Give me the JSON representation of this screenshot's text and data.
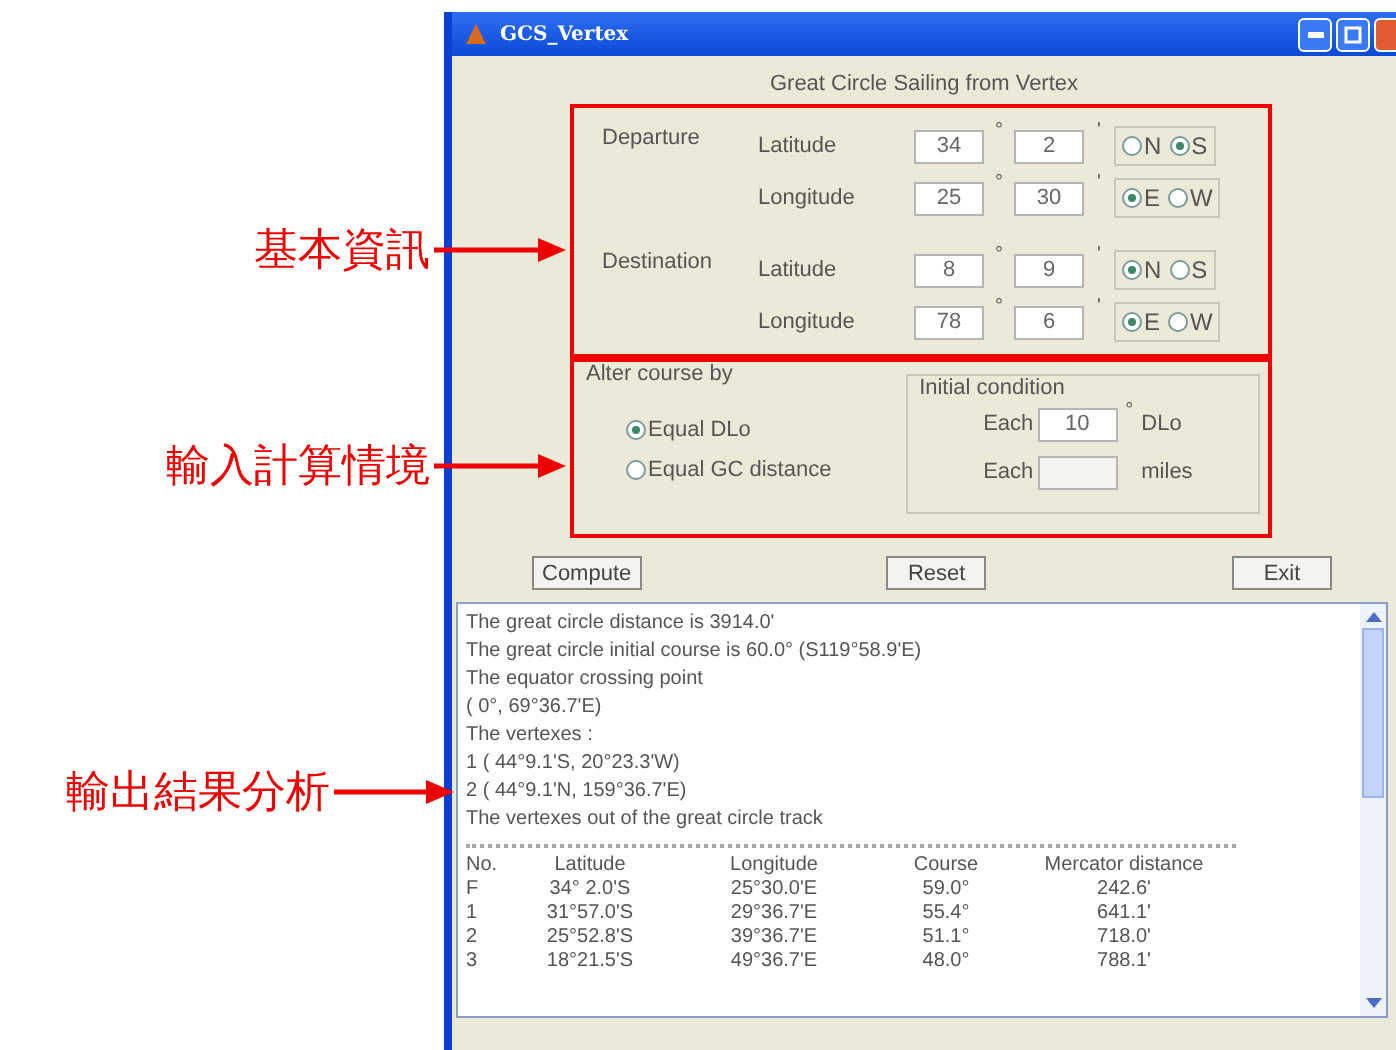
{
  "window": {
    "title": "GCS_Vertex"
  },
  "heading": "Great Circle Sailing from Vertex",
  "positions": [
    {
      "label": "Departure",
      "rows": [
        {
          "label": "Latitude",
          "degrees": "34",
          "degree_mark": "°",
          "minutes": "2",
          "minute_mark": "'",
          "options": [
            {
              "label": "N",
              "selected": false
            },
            {
              "label": "S",
              "selected": true
            }
          ]
        },
        {
          "label": "Longitude",
          "degrees": "25",
          "degree_mark": "°",
          "minutes": "30",
          "minute_mark": "'",
          "options": [
            {
              "label": "E",
              "selected": true
            },
            {
              "label": "W",
              "selected": false
            }
          ]
        }
      ]
    },
    {
      "label": "Destination",
      "rows": [
        {
          "label": "Latitude",
          "degrees": "8",
          "degree_mark": "°",
          "minutes": "9",
          "minute_mark": "'",
          "options": [
            {
              "label": "N",
              "selected": true
            },
            {
              "label": "S",
              "selected": false
            }
          ]
        },
        {
          "label": "Longitude",
          "degrees": "78",
          "degree_mark": "°",
          "minutes": "6",
          "minute_mark": "'",
          "options": [
            {
              "label": "E",
              "selected": true
            },
            {
              "label": "W",
              "selected": false
            }
          ]
        }
      ]
    }
  ],
  "alter_course": {
    "title": "Alter course by",
    "options": [
      {
        "label": "Equal DLo",
        "selected": true
      },
      {
        "label": "Equal GC distance",
        "selected": false
      }
    ],
    "initial_condition": {
      "title": "Initial condition",
      "rows": [
        {
          "label": "Each",
          "value": "10",
          "unit_mark": "°",
          "unit": "DLo",
          "disabled": false
        },
        {
          "label": "Each",
          "unit": "miles",
          "disabled": true
        }
      ]
    }
  },
  "buttons": [
    "Compute",
    "Reset",
    "Exit"
  ],
  "output": {
    "lines": [
      "The great circle distance is 3914.0'",
      "The great circle initial course is 60.0° (S119°58.9'E)",
      "The equator crossing point",
      "( 0°,  69°36.7'E)",
      "The vertexes :",
      "1 ( 44°9.1'S,  20°23.3'W)",
      "2 ( 44°9.1'N, 159°36.7'E)",
      "The vertexes out of the great circle track"
    ],
    "table": {
      "columns": [
        "No.",
        "Latitude",
        "Longitude",
        "Course",
        "Mercator distance"
      ],
      "rows": [
        [
          "F",
          "34° 2.0'S",
          "25°30.0'E",
          "59.0°",
          "242.6'"
        ],
        [
          "1",
          "31°57.0'S",
          "29°36.7'E",
          "55.4°",
          "641.1'"
        ],
        [
          "2",
          "25°52.8'S",
          "39°36.7'E",
          "51.1°",
          "718.0'"
        ],
        [
          "3",
          "18°21.5'S",
          "49°36.7'E",
          "48.0°",
          "788.1'"
        ]
      ]
    }
  },
  "annotations": [
    {
      "label": "基本資訊"
    },
    {
      "label": "輸入計算情境"
    },
    {
      "label": "輸出結果分析"
    }
  ]
}
